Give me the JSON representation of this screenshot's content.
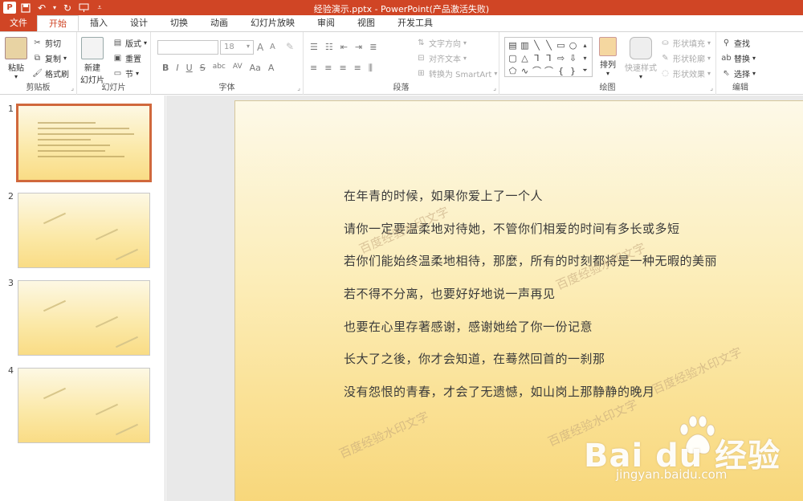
{
  "title_bar": {
    "title": "经验演示.pptx - PowerPoint(产品激活失败)",
    "qat_icons": [
      "powerpoint-logo",
      "save-icon",
      "undo-icon",
      "redo-icon",
      "presenter-icon",
      "customize-icon"
    ]
  },
  "tabs": [
    {
      "label": "文件"
    },
    {
      "label": "开始"
    },
    {
      "label": "插入"
    },
    {
      "label": "设计"
    },
    {
      "label": "切换"
    },
    {
      "label": "动画"
    },
    {
      "label": "幻灯片放映"
    },
    {
      "label": "审阅"
    },
    {
      "label": "视图"
    },
    {
      "label": "开发工具"
    }
  ],
  "ribbon": {
    "clipboard": {
      "label": "剪贴板",
      "paste": "粘贴",
      "cut": "剪切",
      "copy": "复制",
      "format_painter": "格式刷"
    },
    "slides": {
      "label": "幻灯片",
      "new_slide": "新建",
      "new_slide_2": "幻灯片",
      "layout": "版式",
      "reset": "重置",
      "section": "节"
    },
    "font": {
      "label": "字体",
      "size": "18",
      "grow": "A",
      "shrink": "A",
      "bold": "B",
      "italic": "I",
      "underline": "U",
      "strike": "S",
      "shadow": "abc",
      "spacing": "AV",
      "case": "Aa",
      "color": "A"
    },
    "paragraph": {
      "label": "段落",
      "text_direction": "文字方向",
      "align_text": "对齐文本",
      "smartart": "转换为 SmartArt"
    },
    "drawing": {
      "label": "绘图",
      "arrange": "排列",
      "quick_styles": "快速样式",
      "fill": "形状填充",
      "outline": "形状轮廓",
      "effects": "形状效果"
    },
    "editing": {
      "label": "编辑",
      "find": "查找",
      "replace": "替换",
      "select": "选择"
    }
  },
  "slides_pane": {
    "numbers": [
      "1",
      "2",
      "3",
      "4"
    ],
    "selected": 1
  },
  "slide": {
    "lines": [
      "在年青的时候，如果你爱上了一个人",
      "请你一定要温柔地对待她，不管你们相爱的时间有多长或多短",
      "若你们能始终温柔地相待，那麼，所有的时刻都将是一种无暇的美丽",
      "若不得不分离，也要好好地说一声再见",
      "也要在心里存著感谢，感谢她给了你一份记意",
      "长大了之後，你才会知道，在蓦然回首的一刹那",
      "没有怨恨的青春，才会了无遗憾，如山岗上那静静的晚月"
    ],
    "watermark": "百度经验水印文字"
  },
  "baidu": {
    "logo": "Bai du 经验",
    "url": "jingyan.baidu.com"
  }
}
